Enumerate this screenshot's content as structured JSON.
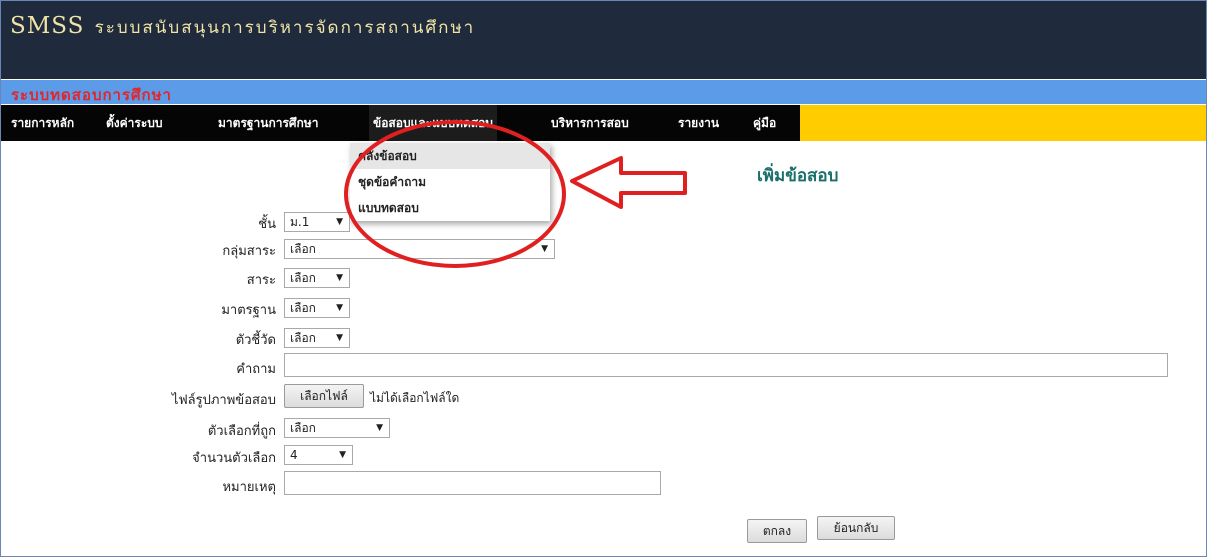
{
  "header": {
    "logo": "SMSS",
    "tagline": "ระบบสนับสนุนการบริหารจัดการสถานศึกษา"
  },
  "system_title": "ระบบทดสอบการศึกษา",
  "menu": {
    "items": [
      "รายการหลัก",
      "ตั้งค่าระบบ",
      "มาตรฐานการศึกษา",
      "ข้อสอบและแบบทดสอบ",
      "บริหารการสอบ",
      "รายงาน",
      "คู่มือ"
    ],
    "dropdown": [
      "คลังข้อสอบ",
      "ชุดข้อคำถาม",
      "แบบทดสอบ"
    ]
  },
  "form": {
    "heading": "เพิ่มข้อสอบ",
    "level_label": "ชั้น",
    "level_value": "ม.1",
    "subject_group_label": "กลุ่มสาระ",
    "subject_group_value": "เลือก",
    "strand_label": "สาระ",
    "strand_value": "เลือก",
    "standard_label": "มาตรฐาน",
    "standard_value": "เลือก",
    "indicator_label": "ตัวชี้วัด",
    "indicator_value": "เลือก",
    "question_label": "คำถาม",
    "image_label": "ไฟล์รูปภาพข้อสอบ",
    "file_button": "เลือกไฟล์",
    "file_status": "ไม่ได้เลือกไฟล์ใด",
    "correct_label": "ตัวเลือกที่ถูก",
    "correct_value": "เลือก",
    "count_label": "จำนวนตัวเลือก",
    "count_value": "4",
    "note_label": "หมายเหตุ",
    "ok_button": "ตกลง",
    "back_button": "ย้อนกลับ"
  },
  "colors": {
    "header_bg": "#1f2a3c",
    "system_bar": "#5b9be8",
    "menu_accent": "#ffcc00",
    "annotation": "#e02020"
  }
}
